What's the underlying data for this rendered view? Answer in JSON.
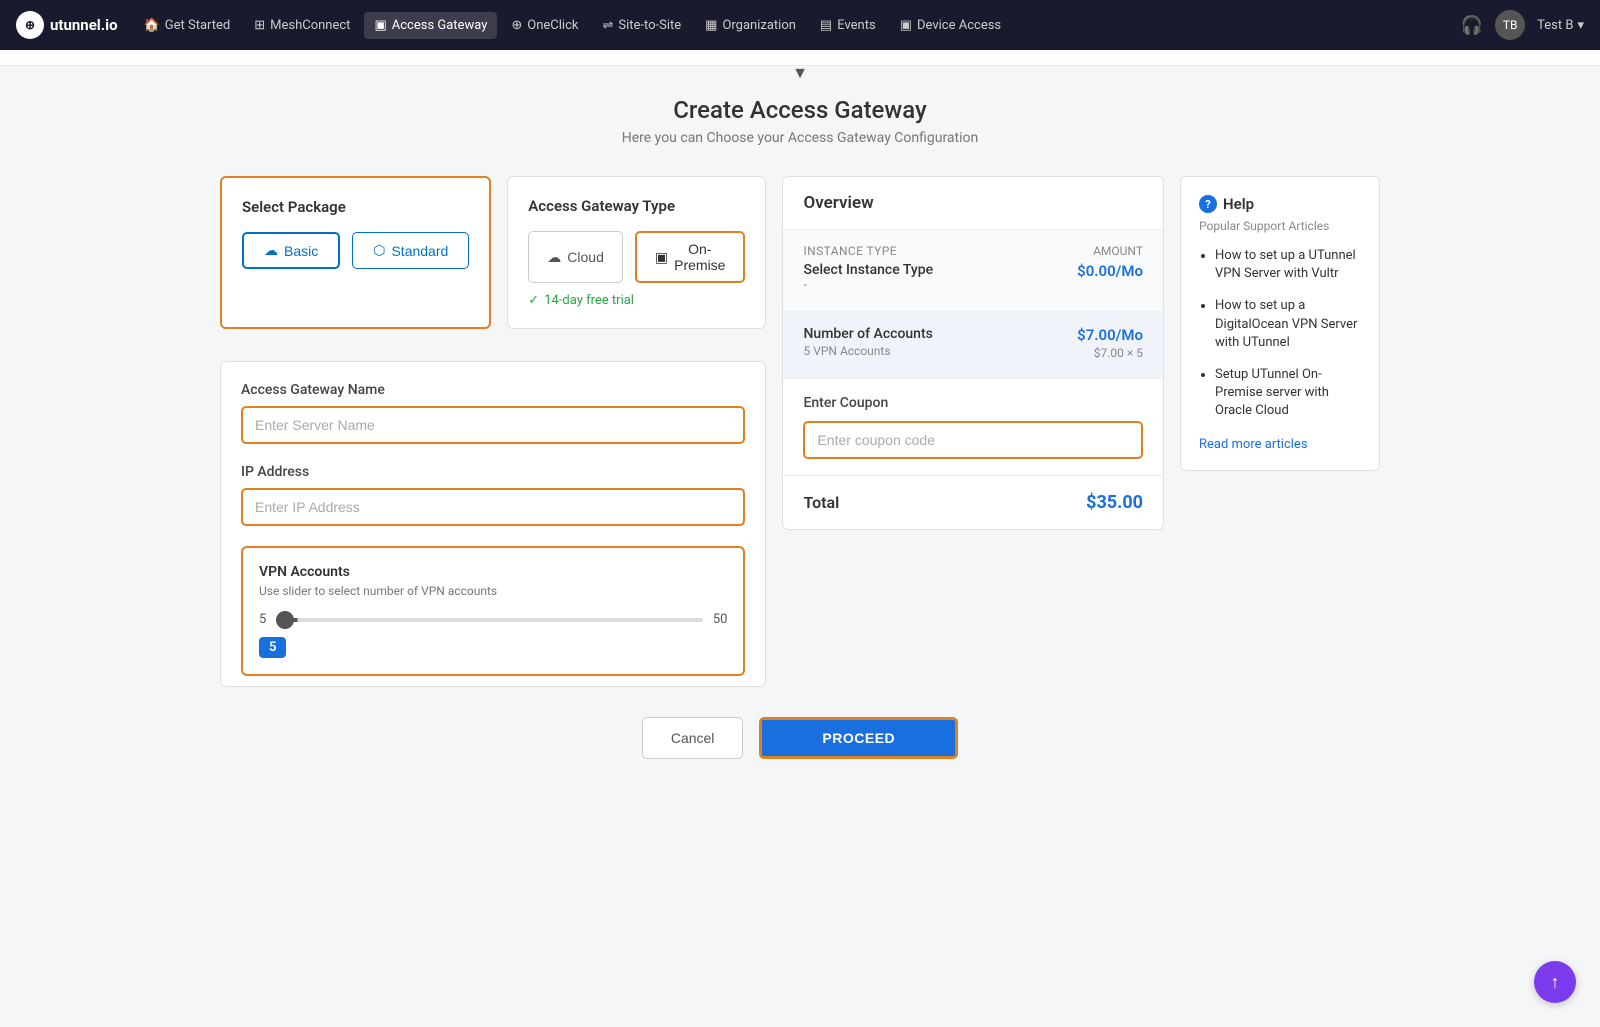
{
  "nav": {
    "logo": "utunnel.io",
    "logo_icon": "⊕",
    "items": [
      {
        "label": "Get Started",
        "icon": "🏠",
        "active": false
      },
      {
        "label": "MeshConnect",
        "icon": "⊞",
        "active": false
      },
      {
        "label": "Access Gateway",
        "icon": "▣",
        "active": true
      },
      {
        "label": "OneClick",
        "icon": "⊕",
        "active": false
      },
      {
        "label": "Site-to-Site",
        "icon": "⇌",
        "active": false
      },
      {
        "label": "Organization",
        "icon": "▦",
        "active": false
      },
      {
        "label": "Events",
        "icon": "▤",
        "active": false
      },
      {
        "label": "Device Access",
        "icon": "▣",
        "active": false
      }
    ],
    "support_icon": "🎧",
    "user": "Test B"
  },
  "page": {
    "title": "Create Access Gateway",
    "subtitle": "Here you can Choose your Access Gateway Configuration"
  },
  "select_package": {
    "title": "Select Package",
    "basic_label": "Basic",
    "standard_label": "Standard",
    "basic_icon": "☁",
    "standard_icon": "⬡"
  },
  "gateway_type": {
    "title": "Access Gateway Type",
    "cloud_label": "Cloud",
    "on_premise_label": "On-Premise",
    "cloud_icon": "☁",
    "on_premise_icon": "▣",
    "free_trial": "14-day free trial"
  },
  "form": {
    "name_label": "Access Gateway Name",
    "name_placeholder": "Enter Server Name",
    "ip_label": "IP Address",
    "ip_placeholder": "Enter IP Address"
  },
  "vpn_accounts": {
    "title": "VPN Accounts",
    "subtitle": "Use slider to select number of VPN accounts",
    "min": "5",
    "max": "50",
    "value": "5",
    "badge_value": "5"
  },
  "overview": {
    "title": "Overview",
    "instance_type_label": "Instance Type",
    "amount_label": "AMOUNT",
    "select_instance_label": "Select Instance Type",
    "instance_price": "$0.00/Mo",
    "instance_dash": "-",
    "accounts_label": "Number of Accounts",
    "accounts_price": "$7.00/Mo",
    "accounts_sub": "$7.00 × 5",
    "accounts_desc": "5 VPN Accounts",
    "coupon_label": "Enter Coupon",
    "coupon_placeholder": "Enter coupon code",
    "total_label": "Total",
    "total_amount": "$35.00"
  },
  "help": {
    "title": "Help",
    "popular_label": "Popular Support Articles",
    "articles": [
      "How to set up a UTunnel VPN Server with Vultr",
      "How to set up a DigitalOcean VPN Server with UTunnel",
      "Setup UTunnel On-Premise server with Oracle Cloud"
    ],
    "read_more": "Read more articles"
  },
  "footer": {
    "cancel_label": "Cancel",
    "proceed_label": "PROCEED"
  },
  "scroll_top_icon": "↑"
}
